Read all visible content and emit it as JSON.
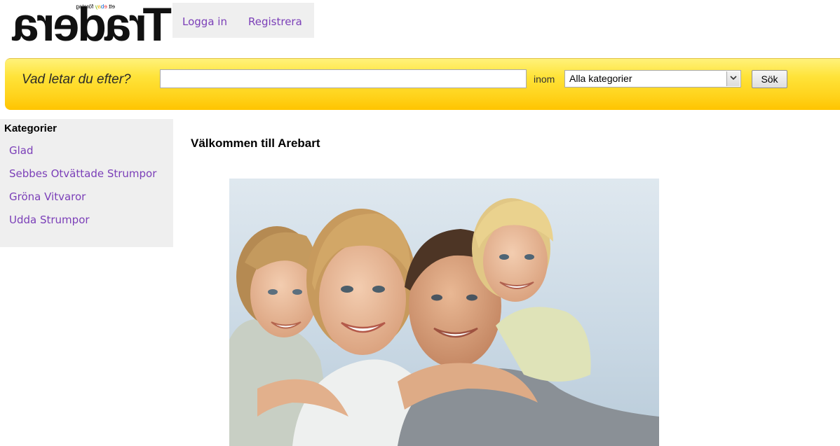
{
  "header": {
    "logo": {
      "wordmark": "Tradera",
      "tagline_prefix": "ett",
      "tagline_brand": "ebay",
      "tagline_suffix": "företag"
    },
    "auth": {
      "login_label": "Logga in",
      "register_label": "Registrera"
    }
  },
  "search": {
    "prompt": "Vad letar du efter?",
    "query_value": "",
    "within_label": "inom",
    "category_selected": "Alla kategorier",
    "submit_label": "Sök"
  },
  "sidebar": {
    "heading": "Kategorier",
    "items": [
      {
        "label": "Glad"
      },
      {
        "label": "Sebbes Otvättade Strumpor"
      },
      {
        "label": "Gröna Vitvaror"
      },
      {
        "label": "Udda Strumpor"
      }
    ]
  },
  "main": {
    "welcome": "Välkommen till Arebart",
    "photo_subject": "family-photo"
  },
  "colors": {
    "link": "#7b3fb8",
    "search_bar": "#ffd21a",
    "panel": "#efefef"
  }
}
